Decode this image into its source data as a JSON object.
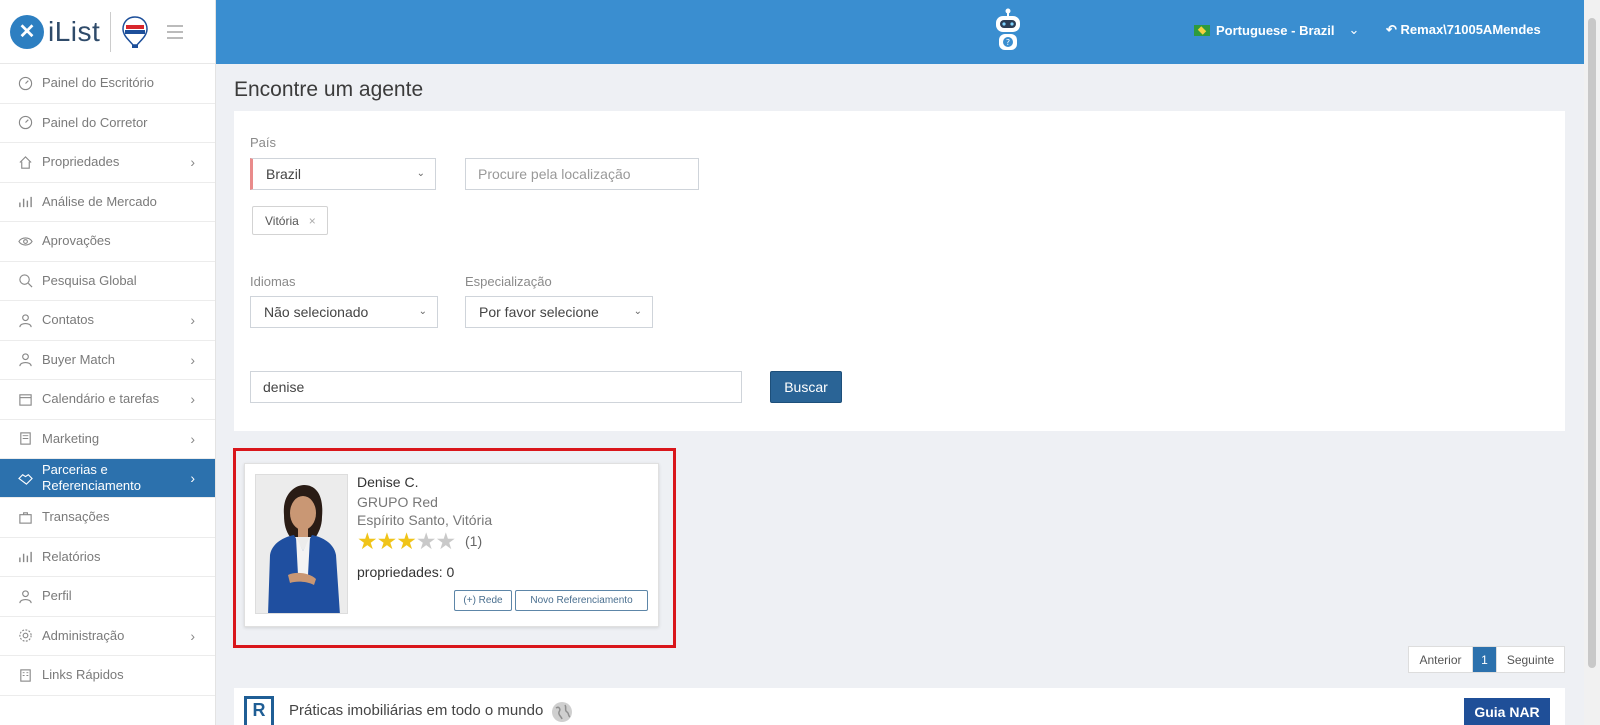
{
  "app": {
    "logo_text": "iList"
  },
  "topbar": {
    "language": "Portuguese - Brazil",
    "user": "Remax\\71005AMendes"
  },
  "sidebar": {
    "items": [
      {
        "label": "Painel do Escritório",
        "icon": "gauge-icon",
        "has_submenu": false
      },
      {
        "label": "Painel do Corretor",
        "icon": "gauge-icon",
        "has_submenu": false
      },
      {
        "label": "Propriedades",
        "icon": "home-icon",
        "has_submenu": true
      },
      {
        "label": "Análise de Mercado",
        "icon": "bar-chart-icon",
        "has_submenu": false
      },
      {
        "label": "Aprovações",
        "icon": "eye-icon",
        "has_submenu": false
      },
      {
        "label": "Pesquisa Global",
        "icon": "search-icon",
        "has_submenu": false
      },
      {
        "label": "Contatos",
        "icon": "contacts-icon",
        "has_submenu": true
      },
      {
        "label": "Buyer Match",
        "icon": "user-icon",
        "has_submenu": true
      },
      {
        "label": "Calendário e tarefas",
        "icon": "calendar-icon",
        "has_submenu": true
      },
      {
        "label": "Marketing",
        "icon": "book-icon",
        "has_submenu": true
      },
      {
        "label": "Parcerias e Referenciamento",
        "icon": "handshake-icon",
        "has_submenu": true,
        "active": true
      },
      {
        "label": "Transações",
        "icon": "briefcase-icon",
        "has_submenu": false
      },
      {
        "label": "Relatórios",
        "icon": "bar-chart-icon",
        "has_submenu": false
      },
      {
        "label": "Perfil",
        "icon": "user-icon",
        "has_submenu": false
      },
      {
        "label": "Administração",
        "icon": "gear-icon",
        "has_submenu": true
      },
      {
        "label": "Links Rápidos",
        "icon": "building-icon",
        "has_submenu": false
      }
    ]
  },
  "page": {
    "title": "Encontre um agente"
  },
  "search": {
    "country_label": "País",
    "country_value": "Brazil",
    "location_placeholder": "Procure pela localização",
    "location_tag": "Vitória",
    "languages_label": "Idiomas",
    "languages_value": "Não selecionado",
    "specialization_label": "Especialização",
    "specialization_value": "Por favor selecione",
    "name_value": "denise",
    "submit_label": "Buscar"
  },
  "result": {
    "name": "Denise C.",
    "company": "GRUPO Red",
    "location": "Espírito Santo, Vitória",
    "rating": 3,
    "rating_max": 5,
    "rating_count": "(1)",
    "properties": "propriedades: 0",
    "network_button": "(+) Rede",
    "referral_button": "Novo Referenciamento"
  },
  "pagination": {
    "prev": "Anterior",
    "current": "1",
    "next": "Seguinte"
  },
  "footer": {
    "text": "Práticas imobiliárias em todo o mundo",
    "button": "Guia NAR"
  },
  "colors": {
    "topbar": "#3a8ed0",
    "active_nav": "#2c71ad",
    "primary_button": "#2a6496",
    "highlight": "#d9161b",
    "star": "#f0c419"
  }
}
